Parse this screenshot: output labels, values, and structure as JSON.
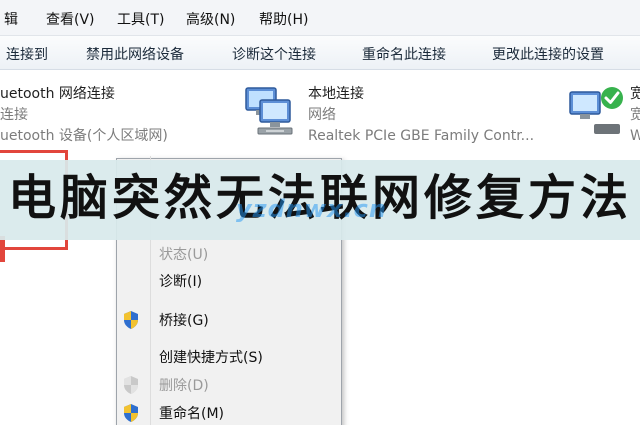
{
  "menubar": {
    "items": [
      "辑",
      "查看(V)",
      "工具(T)",
      "高级(N)",
      "帮助(H)"
    ]
  },
  "toolbar": {
    "buttons": [
      "连接到",
      "禁用此网络设备",
      "诊断这个连接",
      "重命名此连接",
      "更改此连接的设置"
    ]
  },
  "connections": [
    {
      "name": "uetooth 网络连接",
      "status": "连接",
      "device": "uetooth 设备(个人区域网)"
    },
    {
      "name": "本地连接",
      "status": "网络",
      "device": "Realtek PCIe GBE Family Contr..."
    },
    {
      "name": "宽",
      "status": "宽",
      "device": "W"
    }
  ],
  "context_menu": {
    "items": [
      {
        "label": "状态(U)",
        "disabled": true
      },
      {
        "label": "诊断(I)",
        "disabled": false
      },
      {
        "label": "桥接(G)",
        "disabled": false,
        "icon": "shield-icon"
      },
      {
        "label": "创建快捷方式(S)",
        "disabled": false
      },
      {
        "label": "删除(D)",
        "disabled": true,
        "icon": "shield-icon"
      },
      {
        "label": "重命名(M)",
        "disabled": false,
        "icon": "shield-icon"
      }
    ]
  },
  "banner": {
    "title": "电脑突然无法联网修复方法"
  },
  "watermark": {
    "text": "yzdnwx.cn"
  },
  "colors": {
    "highlight_box": "#e2463c",
    "banner_bg": "#d8eaec",
    "shield_blue": "#2f6fcf",
    "shield_yellow": "#f2c230"
  }
}
